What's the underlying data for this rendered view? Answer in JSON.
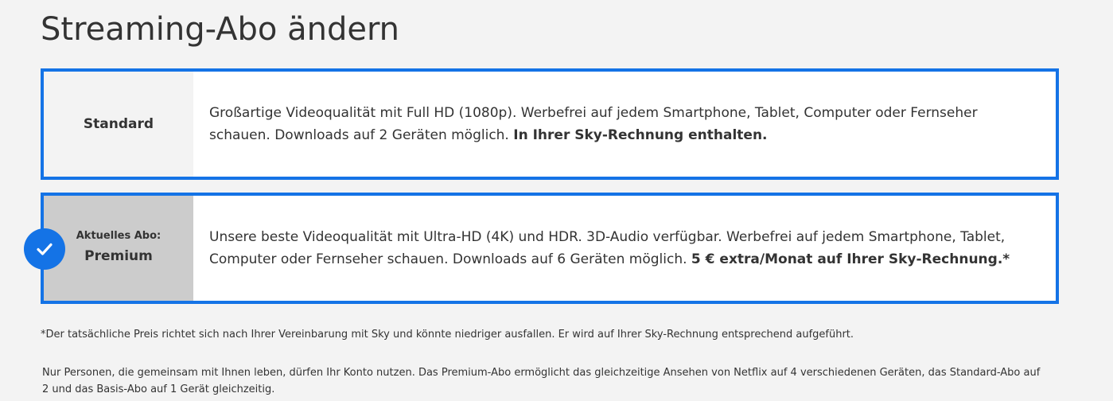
{
  "page": {
    "title": "Streaming-Abo ändern"
  },
  "plans": [
    {
      "name": "Standard",
      "current_label": "",
      "description_lines": [
        "Großartige Videoqualität mit Full HD (1080p). Werbefrei auf jedem Smartphone, Tablet, Computer oder Fernseher",
        "schauen. Downloads auf 2 Geräten möglich. "
      ],
      "description_emphasis": "In Ihrer Sky-Rechnung enthalten.",
      "selected": false
    },
    {
      "name": "Premium",
      "current_label": "Aktuelles Abo:",
      "description_lines": [
        "Unsere beste Videoqualität mit Ultra-HD (4K) und HDR. 3D-Audio verfügbar. Werbefrei auf jedem Smartphone, Tablet,",
        "Computer oder Fernseher schauen. Downloads auf 6 Geräten möglich. "
      ],
      "description_emphasis": "5 € extra/Monat auf Ihrer Sky-Rechnung.*",
      "selected": true
    }
  ],
  "footnote": "*Der tatsächliche Preis richtet sich nach Ihrer Vereinbarung mit Sky und könnte niedriger ausfallen. Er wird auf Ihrer Sky-Rechnung entsprechend aufgeführt.",
  "info_text_lines": [
    "Nur Personen, die gemeinsam mit Ihnen leben, dürfen Ihr Konto nutzen. Das Premium-Abo ermöglicht das gleichzeitige Ansehen von Netflix auf 4 verschiedenen Geräten, das Standard-Abo auf",
    "2 und das Basis-Abo auf 1 Gerät gleichzeitig."
  ],
  "icons": {
    "selected_badge": "checkmark-icon"
  },
  "colors": {
    "accent": "#1473e6",
    "background": "#f3f3f3",
    "card_background": "#ffffff",
    "current_plan_label_background": "#cccccc",
    "text": "#333333"
  }
}
